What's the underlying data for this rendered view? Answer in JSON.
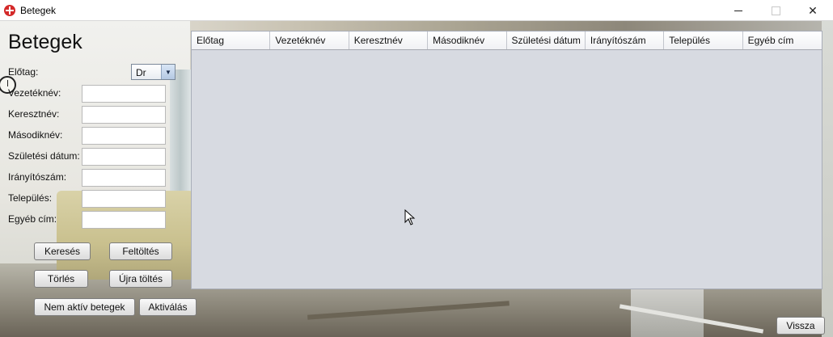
{
  "window": {
    "title": "Betegek",
    "controls": {
      "minimize": "minimize",
      "maximize": "maximize",
      "close": "✕"
    }
  },
  "form": {
    "title": "Betegek",
    "prefix": {
      "label": "Előtag:",
      "value": "Dr"
    },
    "fields": [
      {
        "label": "Vezetéknév:",
        "value": ""
      },
      {
        "label": "Keresztnév:",
        "value": ""
      },
      {
        "label": "Másodiknév:",
        "value": ""
      },
      {
        "label": "Születési dátum:",
        "value": ""
      },
      {
        "label": "Irányítószám:",
        "value": ""
      },
      {
        "label": "Település:",
        "value": ""
      },
      {
        "label": "Egyéb cím:",
        "value": ""
      }
    ],
    "buttons": {
      "search": "Keresés",
      "upload": "Feltöltés",
      "delete": "Törlés",
      "reload": "Újra töltés",
      "inactive": "Nem aktív betegek",
      "activate": "Aktiválás"
    }
  },
  "table": {
    "columns": [
      "Előtag",
      "Vezetéknév",
      "Keresztnév",
      "Másodiknév",
      "Születési dátum",
      "Irányítószám",
      "Település",
      "Egyéb cím"
    ],
    "rows": []
  },
  "footer": {
    "back": "Vissza"
  }
}
